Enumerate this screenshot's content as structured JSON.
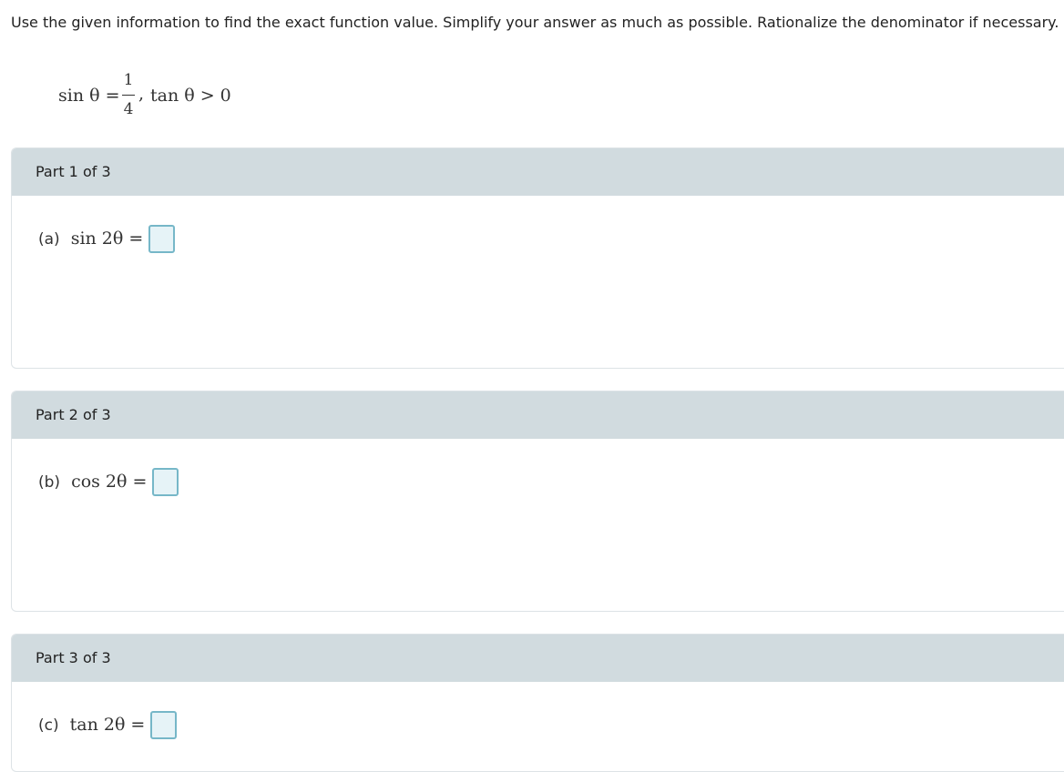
{
  "instructions": "Use the given information to find the exact function value. Simplify your answer as much as possible. Rationalize the denominator if necessary.",
  "given": {
    "sin_lhs": "sin θ =",
    "sin_numerator": "1",
    "sin_denominator": "4",
    "separator": ",",
    "tan_condition": "tan θ > 0"
  },
  "parts": [
    {
      "title": "Part 1 of 3",
      "label": "(a)",
      "expression": "sin 2θ ="
    },
    {
      "title": "Part 2 of 3",
      "label": "(b)",
      "expression": "cos 2θ ="
    },
    {
      "title": "Part 3 of 3",
      "label": "(c)",
      "expression": "tan 2θ ="
    }
  ],
  "colors": {
    "header_bg": "#d1dbdf",
    "answer_border": "#76b7c8",
    "answer_fill": "#e6f3f7"
  }
}
